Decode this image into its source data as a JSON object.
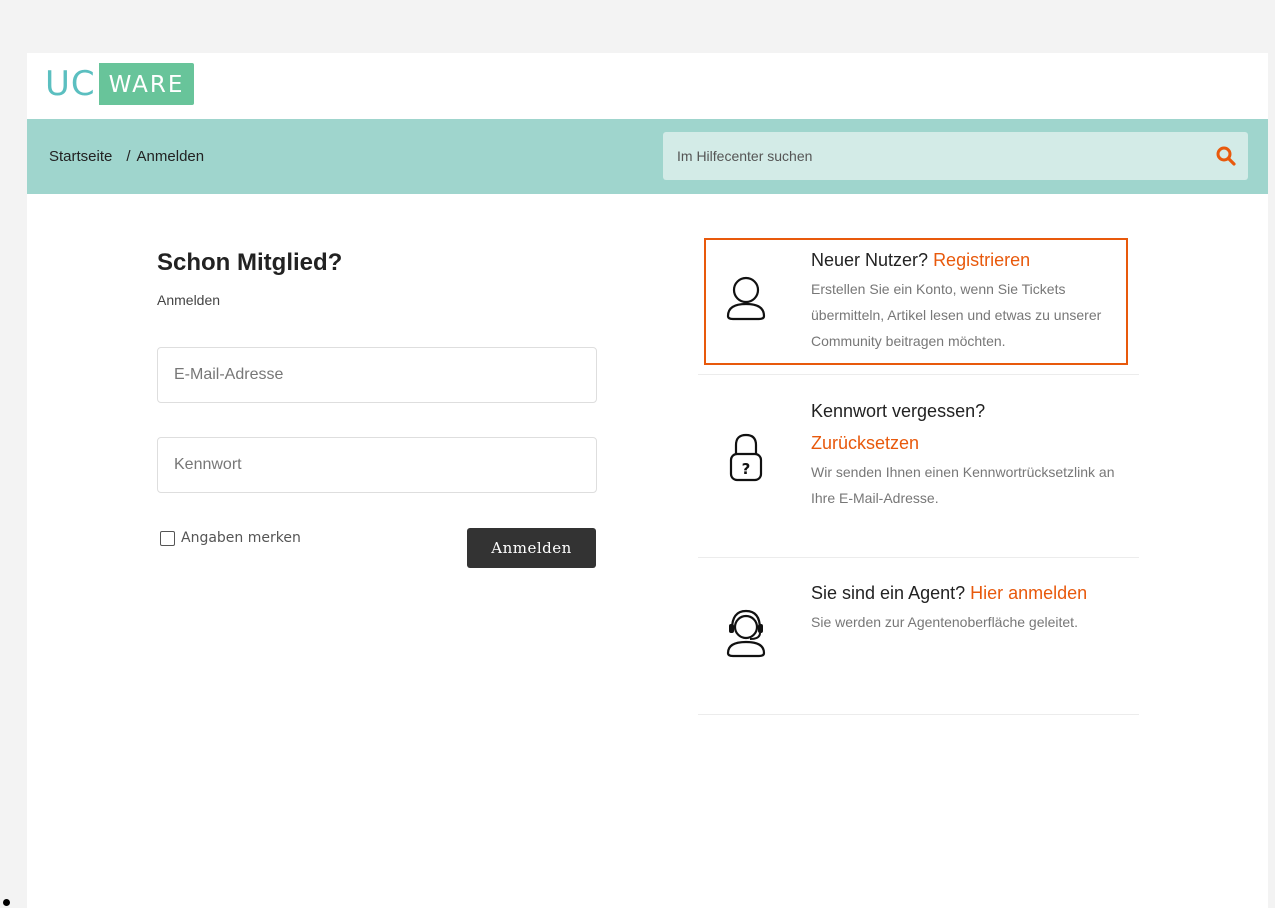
{
  "logo": {
    "part1": "UC",
    "part2": "WARE"
  },
  "breadcrumb": {
    "home": "Startseite",
    "separator": "/",
    "current": "Anmelden"
  },
  "search": {
    "placeholder": "Im Hilfecenter suchen",
    "icon": "search-icon"
  },
  "login": {
    "title": "Schon Mitglied?",
    "subtitle": "Anmelden",
    "email_placeholder": "E-Mail-Adresse",
    "password_placeholder": "Kennwort",
    "remember_label": "Angaben merken",
    "remember_checked": false,
    "submit_label": "Anmelden"
  },
  "cards": [
    {
      "icon": "user-icon",
      "title_prefix": "Neuer Nutzer? ",
      "link": "Registrieren",
      "description": "Erstellen Sie ein Konto, wenn Sie Tickets übermitteln, Artikel lesen und etwas zu unserer Community beitragen möchten.",
      "highlighted": true
    },
    {
      "icon": "lock-question-icon",
      "title_prefix": "Kennwort vergessen?",
      "link": "Zurücksetzen",
      "description": "Wir senden Ihnen einen Kennwortrücksetzlink an Ihre E-Mail-Adresse."
    },
    {
      "icon": "agent-headset-icon",
      "title_prefix": "Sie sind ein Agent? ",
      "link": "Hier anmelden",
      "description": "Sie werden zur Agentenoberfläche geleitet."
    }
  ],
  "colors": {
    "accent": "#e8590c",
    "navbar": "#9fd5cd",
    "logo_teal": "#5bbfc0",
    "logo_green": "#68c49a"
  }
}
